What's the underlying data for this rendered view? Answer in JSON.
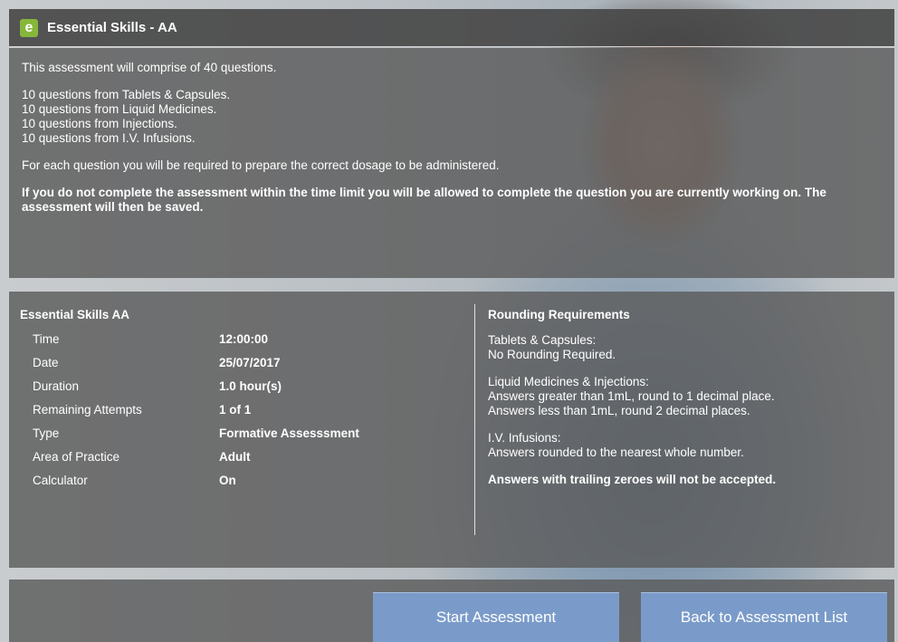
{
  "window": {
    "title": "Essential Skills - AA",
    "logo_letter": "e"
  },
  "intro": {
    "line1": "This assessment will comprise of 40 questions.",
    "q1": "10 questions from Tablets & Capsules.",
    "q2": "10 questions from Liquid Medicines.",
    "q3": "10 questions from Injections.",
    "q4": "10 questions from I.V. Infusions.",
    "prepare": "For each question you will be required to prepare the correct dosage to be administered.",
    "warning": "If you do not complete the assessment within the time limit you will be allowed to complete the question you are currently working on. The assessment will then be saved."
  },
  "details": {
    "heading": "Essential Skills AA",
    "rows": [
      {
        "label": "Time",
        "value": "12:00:00"
      },
      {
        "label": "Date",
        "value": "25/07/2017"
      },
      {
        "label": "Duration",
        "value": "1.0 hour(s)"
      },
      {
        "label": "Remaining Attempts",
        "value": "1 of 1"
      },
      {
        "label": "Type",
        "value": "Formative Assesssment"
      },
      {
        "label": "Area of Practice",
        "value": "Adult"
      },
      {
        "label": "Calculator",
        "value": "On"
      }
    ]
  },
  "rounding": {
    "heading": "Rounding Requirements",
    "tablets_title": "Tablets & Capsules:",
    "tablets_rule": "No Rounding Required.",
    "liquid_title": "Liquid Medicines & Injections:",
    "liquid_rule1": "Answers greater than 1mL, round to 1 decimal place.",
    "liquid_rule2": "Answers less than 1mL, round 2 decimal places.",
    "iv_title": "I.V. Infusions:",
    "iv_rule": "Answers rounded to the nearest whole number.",
    "trailing": "Answers with trailing zeroes will not be accepted."
  },
  "buttons": {
    "start": "Start Assessment",
    "back": "Back to Assessment List"
  }
}
